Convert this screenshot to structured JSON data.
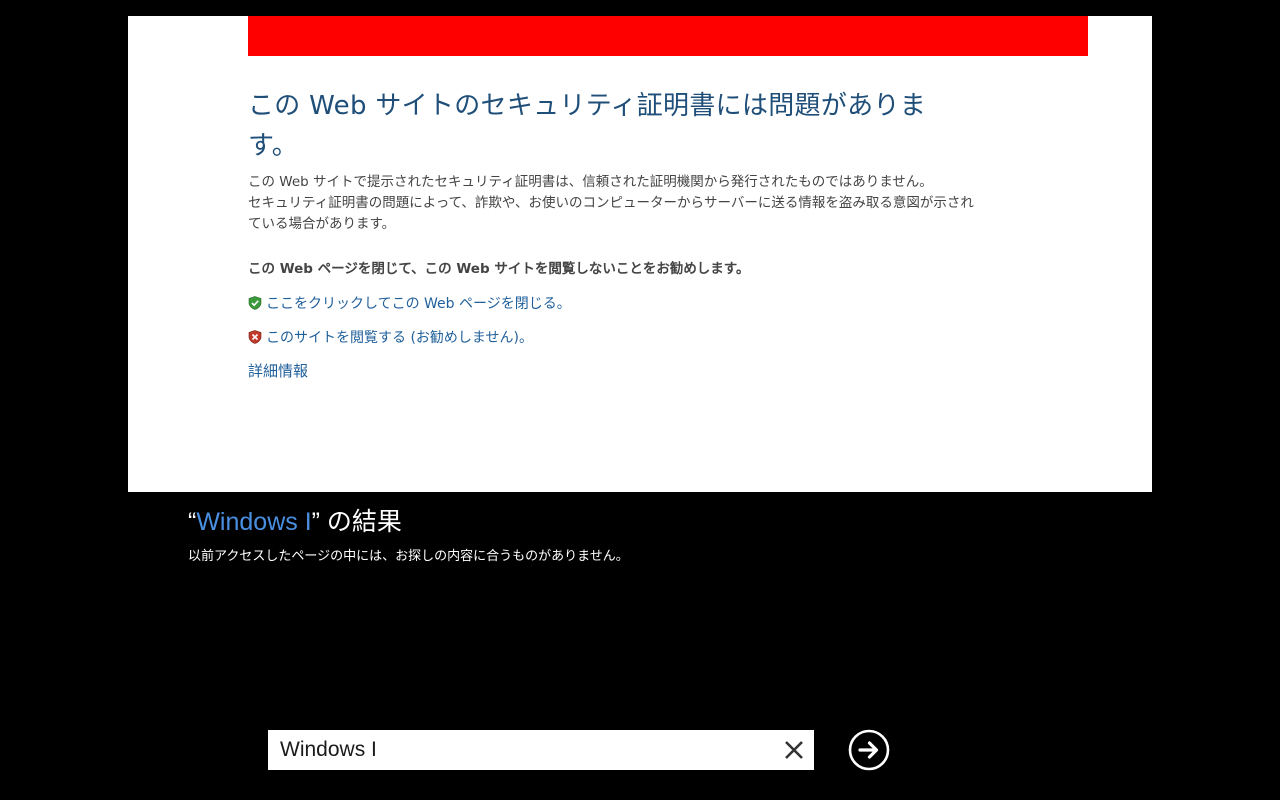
{
  "cert_page": {
    "title": "この Web サイトのセキュリティ証明書には問題があります。",
    "desc_line1": "この Web サイトで提示されたセキュリティ証明書は、信頼された証明機関から発行されたものではありません。",
    "desc_line2": "セキュリティ証明書の問題によって、詐欺や、お使いのコンピューターからサーバーに送る情報を盗み取る意図が示されている場合があります。",
    "recommendation": "この Web ページを閉じて、この Web サイトを閲覧しないことをお勧めします。",
    "close_link": "ここをクリックしてこの Web ページを閉じる。",
    "continue_link": "このサイトを閲覧する (お勧めしません)。",
    "more_info": "詳細情報",
    "banner_color": "#ff0000",
    "close_icon": "green-shield-check-icon",
    "continue_icon": "red-shield-x-icon"
  },
  "results": {
    "open_quote": "“",
    "query": "Windows I",
    "close_quote": "” の結果",
    "message": "以前アクセスしたページの中には、お探しの内容に合うものがありません。",
    "query_color": "#4a90e2"
  },
  "search": {
    "value": "Windows I",
    "clear_icon": "close-icon",
    "go_icon": "arrow-right-circle-icon"
  }
}
